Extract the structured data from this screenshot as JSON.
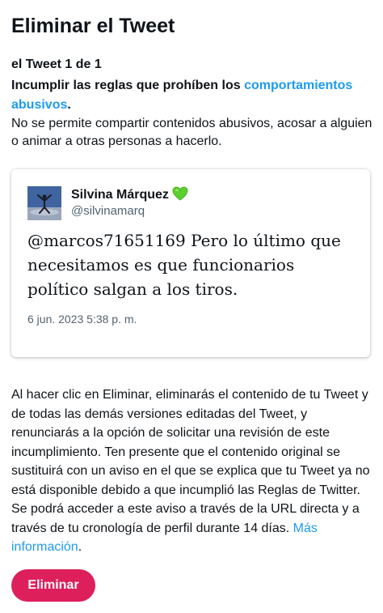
{
  "page": {
    "title": "Eliminar el Tweet",
    "counter": "el Tweet 1 de 1"
  },
  "rule": {
    "heading": "Incumplir las reglas que prohíben los ",
    "link": "comportamientos abusivos",
    "heading_end": ".",
    "description": "No se permite compartir contenidos abusivos, acosar a alguien o animar a otras personas a hacerlo."
  },
  "tweet": {
    "author_name": "Silvina Márquez",
    "author_handle": "@silvinamarq",
    "badge_icon": "green-heart-icon",
    "text": "@marcos71651169 Pero lo último que necesitamos es que funcionarios político salgan a los tiros.",
    "date": "6 jun. 2023 5:38 p. m."
  },
  "explanation": {
    "text": "Al hacer clic en Eliminar, eliminarás el contenido de tu Tweet y de todas las demás versiones editadas del Tweet, y renunciarás a la opción de solicitar una revisión de este incumplimiento. Ten presente que el contenido original se sustituirá con un aviso en el que se explica que tu Tweet ya no está disponible debido a que incumplió las Reglas de Twitter. Se podrá acceder a este aviso a través de la URL directa y a través de tu cronología de perfil durante 14 días. ",
    "link": "Más información",
    "end": "."
  },
  "actions": {
    "delete_label": "Eliminar"
  },
  "colors": {
    "accent_link": "#1d9bf0",
    "delete_button": "#dd1f5c",
    "secondary_text": "#536471"
  }
}
